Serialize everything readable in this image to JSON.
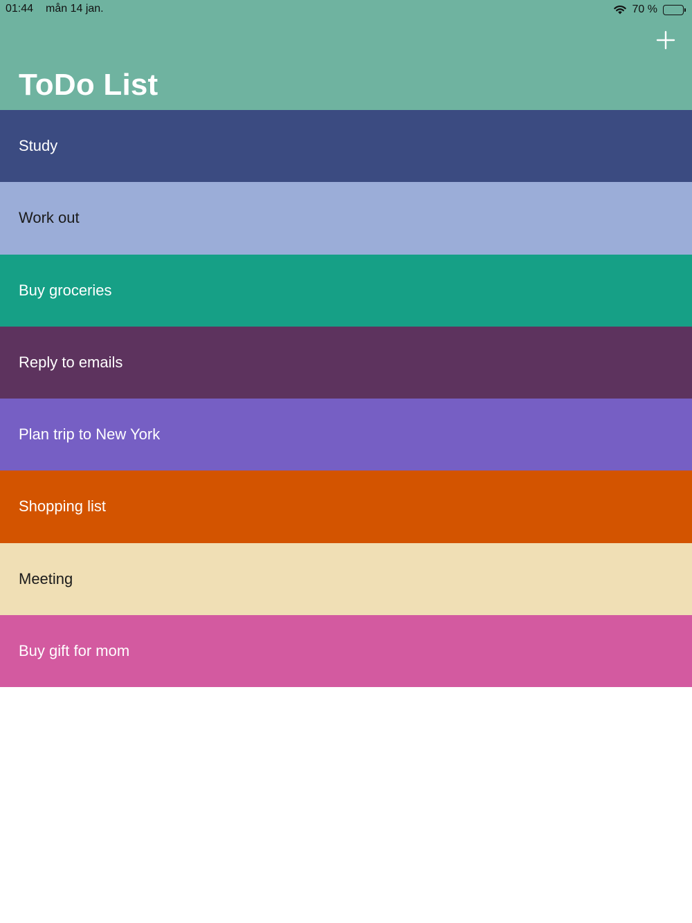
{
  "status_bar": {
    "time": "01:44",
    "date": "mån 14 jan.",
    "battery_text": "70 %",
    "battery_level": 0.7,
    "icons": [
      "wifi-icon",
      "battery-icon"
    ]
  },
  "header": {
    "title": "ToDo List",
    "background": "#6fb3a0",
    "add_icon": "plus-icon"
  },
  "todos": [
    {
      "label": "Study",
      "color": "#3b4b81",
      "text_color": "#ffffff"
    },
    {
      "label": "Work out",
      "color": "#9badd8",
      "text_color": "#1b1b1b"
    },
    {
      "label": "Buy groceries",
      "color": "#16a086",
      "text_color": "#ffffff"
    },
    {
      "label": "Reply to emails",
      "color": "#5d335e",
      "text_color": "#ffffff"
    },
    {
      "label": "Plan trip to New York",
      "color": "#765fc4",
      "text_color": "#ffffff"
    },
    {
      "label": "Shopping list",
      "color": "#d35400",
      "text_color": "#ffffff"
    },
    {
      "label": "Meeting",
      "color": "#f0dfb5",
      "text_color": "#1b1b1b"
    },
    {
      "label": "Buy gift for mom",
      "color": "#d35aa0",
      "text_color": "#ffffff"
    }
  ]
}
